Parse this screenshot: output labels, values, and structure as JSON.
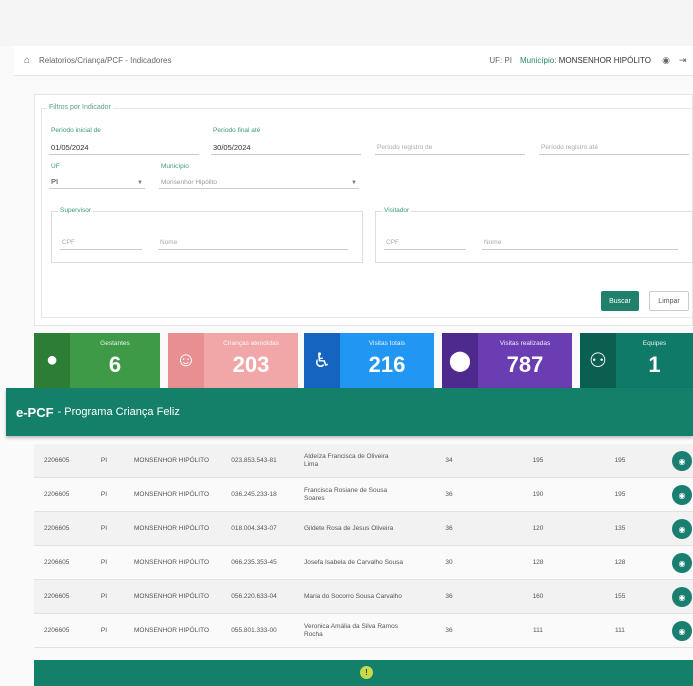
{
  "header": {
    "breadcrumb": "Relatorios/Criança/PCF - Indicadores",
    "uf": "UF: PI",
    "municipio_label": "Município:",
    "municipio_value": "MONSENHOR HIPÓLITO",
    "eye_icon": "eye-icon",
    "logout_icon": "logout-icon"
  },
  "filters": {
    "legend": "Filtros por Indicador",
    "period_start_label": "Período inicial de",
    "period_start_value": "01/05/2024",
    "period_end_label": "Período final até",
    "period_end_value": "30/05/2024",
    "reg_start_placeholder": "Período registro de",
    "reg_end_placeholder": "Período registro até",
    "uf_label": "UF",
    "uf_value": "PI",
    "municipio_label": "Município",
    "municipio_value": "Monsenhor Hipólito",
    "supervisor_title": "Supervisor",
    "supervisor_cpf": "CPF",
    "supervisor_name": "Nome",
    "visitor_title": "Visitador",
    "visitor_cpf": "CPF",
    "visitor_name": "Nome",
    "search_label": "Buscar",
    "clear_label": "Limpar"
  },
  "cards": [
    {
      "title": "Gestantes",
      "value": "6",
      "color": "#3f9a48",
      "icon_color": "#2e7d37",
      "icon": "person-icon"
    },
    {
      "title": "Crianças atendidas",
      "value": "203",
      "color": "#f1a7a8",
      "icon_color": "#e88f91",
      "icon": "baby-icon"
    },
    {
      "title": "Visitas totais",
      "value": "216",
      "color": "#2196f3",
      "icon_color": "#1565c0",
      "icon": "walking-icon"
    },
    {
      "title": "Visitas realizadas",
      "value": "787",
      "color": "#6a3db2",
      "icon_color": "#4e2a8e",
      "icon": "location-icon"
    },
    {
      "title": "Equipes",
      "value": "1",
      "color": "#0f7a68",
      "icon_color": "#0b5f51",
      "icon": "group-icon"
    }
  ],
  "banner": {
    "brand": "e-PCF",
    "title": "- Programa Criança Feliz"
  },
  "table": {
    "rows": [
      {
        "ibge": "2206605",
        "uf": "PI",
        "mun": "MONSENHOR HIPÓLITO",
        "cpf": "023.853.543-81",
        "name": "Aldeíza Francisca de Oliveira Lima",
        "c1": "34",
        "c2": "195",
        "c3": "195"
      },
      {
        "ibge": "2206605",
        "uf": "PI",
        "mun": "MONSENHOR HIPÓLITO",
        "cpf": "036.245.233-18",
        "name": "Francisca Rosiane de Sousa Soares",
        "c1": "36",
        "c2": "190",
        "c3": "195"
      },
      {
        "ibge": "2206605",
        "uf": "PI",
        "mun": "MONSENHOR HIPÓLITO",
        "cpf": "018.004.343-07",
        "name": "Gildete Rosa de Jesus Oliveira",
        "c1": "36",
        "c2": "120",
        "c3": "135"
      },
      {
        "ibge": "2206605",
        "uf": "PI",
        "mun": "MONSENHOR HIPÓLITO",
        "cpf": "066.235.353-45",
        "name": "Josefa Isabela de Carvalho Sousa",
        "c1": "30",
        "c2": "128",
        "c3": "128"
      },
      {
        "ibge": "2206605",
        "uf": "PI",
        "mun": "MONSENHOR HIPÓLITO",
        "cpf": "056.220.633-04",
        "name": "Maria do Socorro Sousa Carvalho",
        "c1": "36",
        "c2": "160",
        "c3": "155"
      },
      {
        "ibge": "2206605",
        "uf": "PI",
        "mun": "MONSENHOR HIPÓLITO",
        "cpf": "055.801.333-00",
        "name": "Veronica Amália da Silva Ramos Rocha",
        "c1": "36",
        "c2": "111",
        "c3": "111"
      }
    ]
  },
  "colors": {
    "brand": "#15806a",
    "accent": "#3d9b7b"
  }
}
